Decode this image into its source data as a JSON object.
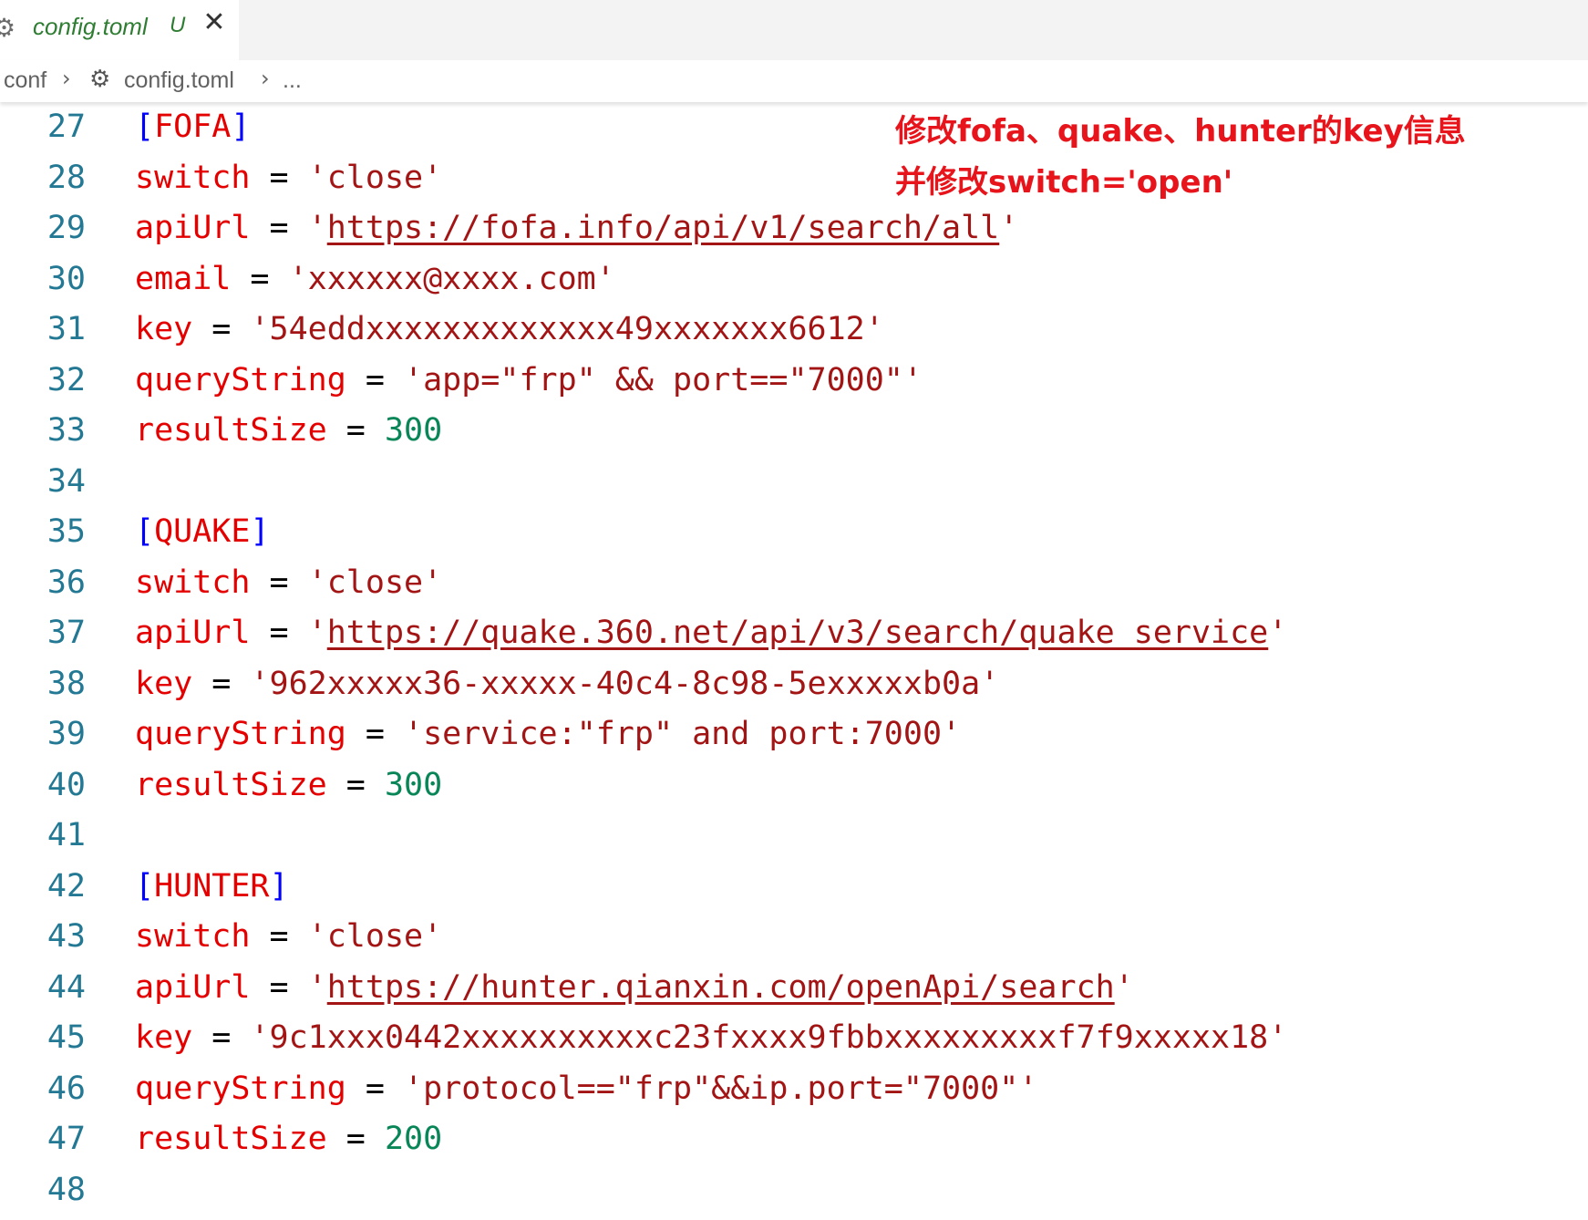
{
  "tab": {
    "title": "config.toml",
    "status": "U",
    "close_glyph": "✕",
    "icon": "gear-icon"
  },
  "breadcrumb": {
    "folder": "conf",
    "file": "config.toml",
    "more": "..."
  },
  "annotation": {
    "line1": "修改fofa、quake、hunter的key信息",
    "line2": "并修改switch='open'"
  },
  "code": {
    "l27": {
      "num": "27",
      "open": "[",
      "name": "FOFA",
      "close": "]"
    },
    "l28": {
      "num": "28",
      "key": "switch",
      "eq": " = ",
      "val": "'close'"
    },
    "l29": {
      "num": "29",
      "key": "apiUrl",
      "eq": " = ",
      "q1": "'",
      "url": "https://fofa.info/api/v1/search/all",
      "q2": "'"
    },
    "l30": {
      "num": "30",
      "key": "email",
      "eq": " = ",
      "val": "'xxxxxx@xxxx.com'"
    },
    "l31": {
      "num": "31",
      "key": "key",
      "eq": " = ",
      "val": "'54eddxxxxxxxxxxxxx49xxxxxxx6612'"
    },
    "l32": {
      "num": "32",
      "key": "queryString",
      "eq": " = ",
      "val": "'app=\"frp\" && port==\"7000\"'"
    },
    "l33": {
      "num": "33",
      "key": "resultSize",
      "eq": " = ",
      "val": "300"
    },
    "l34": {
      "num": "34"
    },
    "l35": {
      "num": "35",
      "open": "[",
      "name": "QUAKE",
      "close": "]"
    },
    "l36": {
      "num": "36",
      "key": "switch",
      "eq": " = ",
      "val": "'close'"
    },
    "l37": {
      "num": "37",
      "key": "apiUrl",
      "eq": " = ",
      "q1": "'",
      "url": "https://quake.360.net/api/v3/search/quake_service",
      "q2": "'"
    },
    "l38": {
      "num": "38",
      "key": "key",
      "eq": " = ",
      "val": "'962xxxxx36-xxxxx-40c4-8c98-5exxxxxb0a'"
    },
    "l39": {
      "num": "39",
      "key": "queryString",
      "eq": " = ",
      "val": "'service:\"frp\" and port:7000'"
    },
    "l40": {
      "num": "40",
      "key": "resultSize",
      "eq": " = ",
      "val": "300"
    },
    "l41": {
      "num": "41"
    },
    "l42": {
      "num": "42",
      "open": "[",
      "name": "HUNTER",
      "close": "]"
    },
    "l43": {
      "num": "43",
      "key": "switch",
      "eq": " = ",
      "val": "'close'"
    },
    "l44": {
      "num": "44",
      "key": "apiUrl",
      "eq": " = ",
      "q1": "'",
      "url": "https://hunter.qianxin.com/openApi/search",
      "q2": "'"
    },
    "l45": {
      "num": "45",
      "key": "key",
      "eq": " = ",
      "val": "'9c1xxx0442xxxxxxxxxxc23fxxxx9fbbxxxxxxxxxf7f9xxxxx18'"
    },
    "l46": {
      "num": "46",
      "key": "queryString",
      "eq": " = ",
      "val": "'protocol==\"frp\"&&ip.port=\"7000\"'"
    },
    "l47": {
      "num": "47",
      "key": "resultSize",
      "eq": " = ",
      "val": "200"
    },
    "l48": {
      "num": "48"
    }
  },
  "colors": {
    "key": "#e50000",
    "string": "#a31515",
    "number": "#098658",
    "bracket": "#0000ff",
    "line_number": "#237893",
    "annotation": "#e8141b",
    "tab_title": "#2e7d32"
  }
}
